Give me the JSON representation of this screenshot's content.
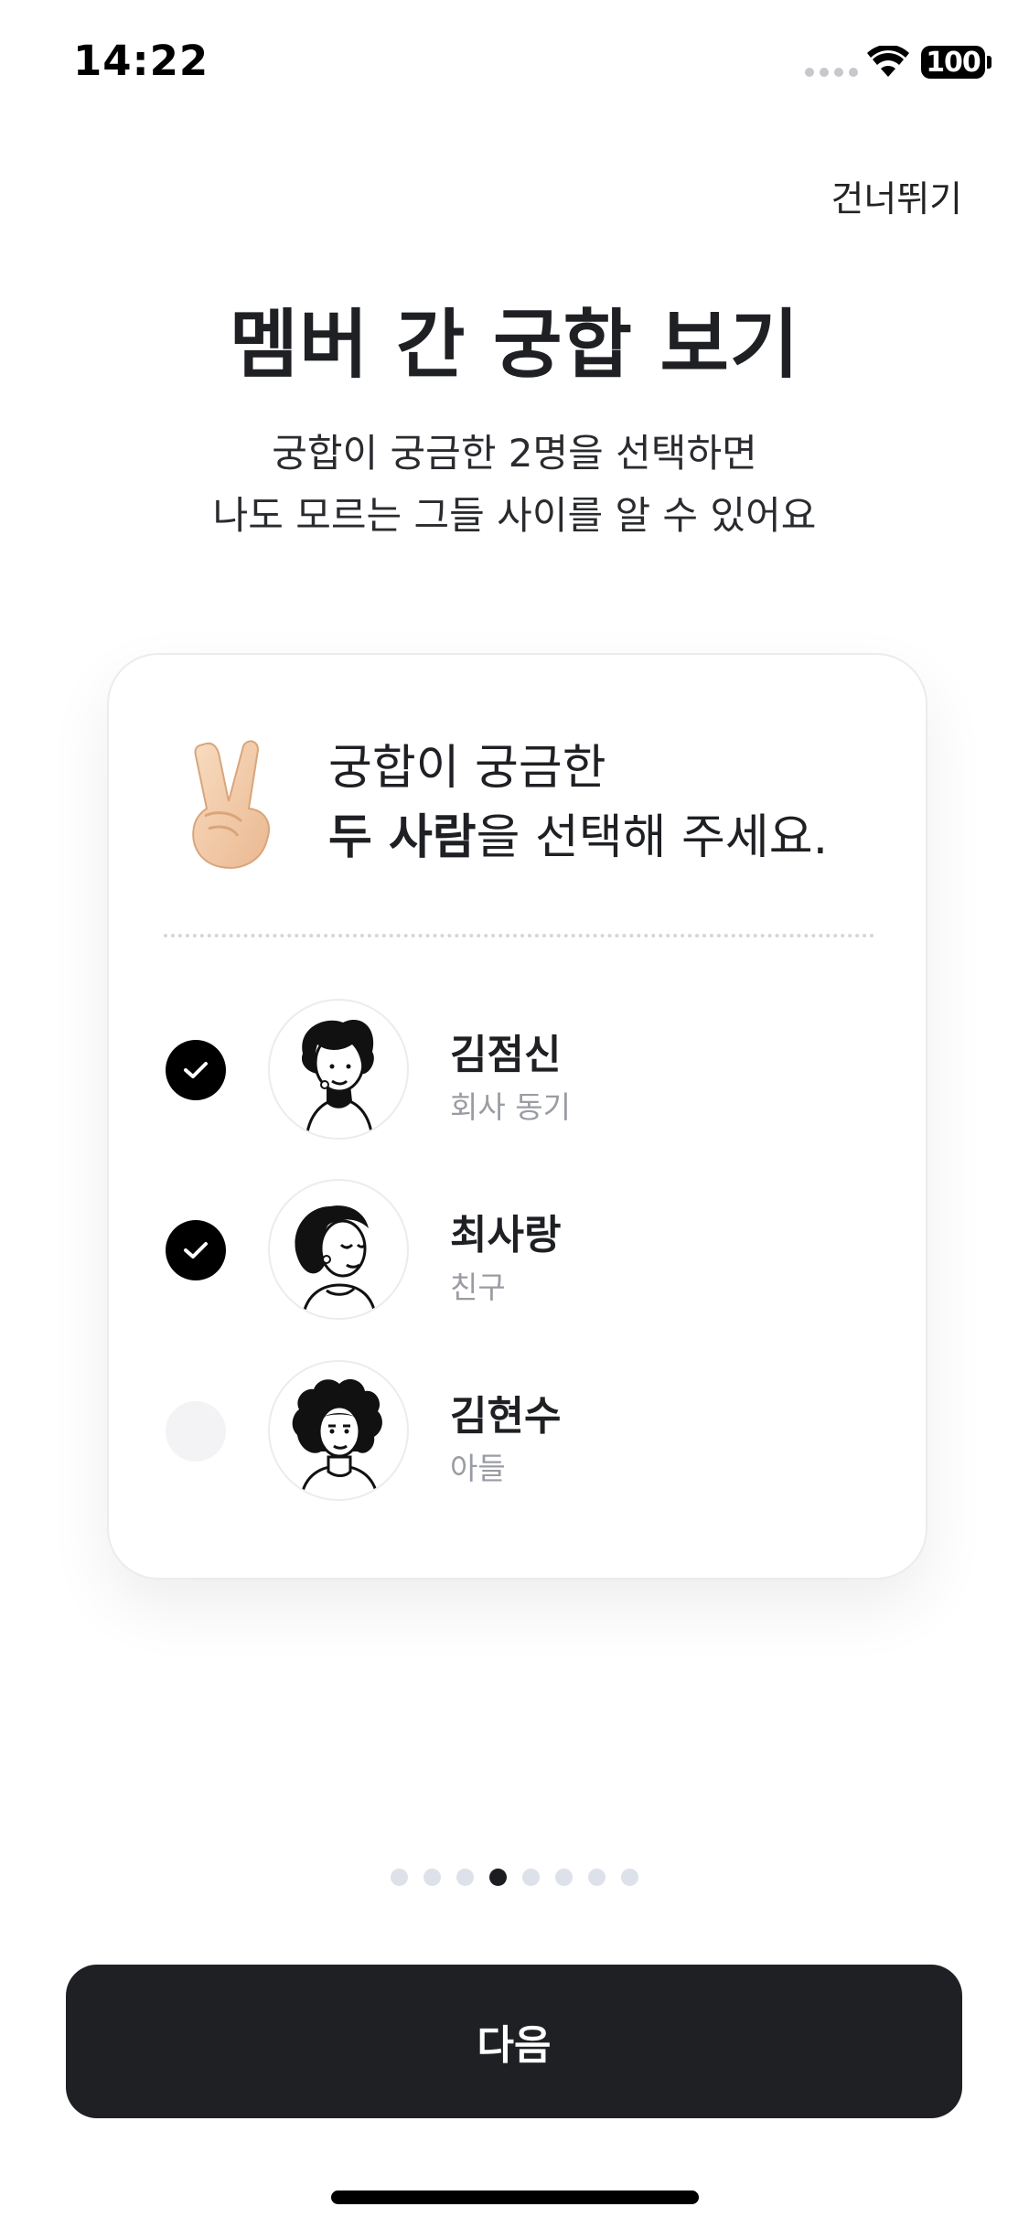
{
  "status_bar": {
    "time": "14:22",
    "battery": "100"
  },
  "header": {
    "skip_label": "건너뛰기"
  },
  "main": {
    "title": "멤버 간 궁합 보기",
    "subtitle_line1": "궁합이 궁금한 2명을 선택하면",
    "subtitle_line2": "나도 모르는 그들 사이를 알 수 있어요"
  },
  "card": {
    "prompt_line1": "궁합이 궁금한",
    "prompt_bold": "두 사람",
    "prompt_rest": "을 선택해 주세요.",
    "members": [
      {
        "name": "김점신",
        "relation": "회사 동기",
        "selected": true
      },
      {
        "name": "최사랑",
        "relation": "친구",
        "selected": true
      },
      {
        "name": "김현수",
        "relation": "아들",
        "selected": false
      }
    ]
  },
  "pager": {
    "total": 8,
    "current": 4
  },
  "footer": {
    "next_label": "다음"
  },
  "colors": {
    "primary_dark": "#1f2024",
    "check_selected": "#000000",
    "check_unselected": "#f3f3f5",
    "pager_inactive": "#dde1ea",
    "relation_text": "#9a9ca3"
  }
}
